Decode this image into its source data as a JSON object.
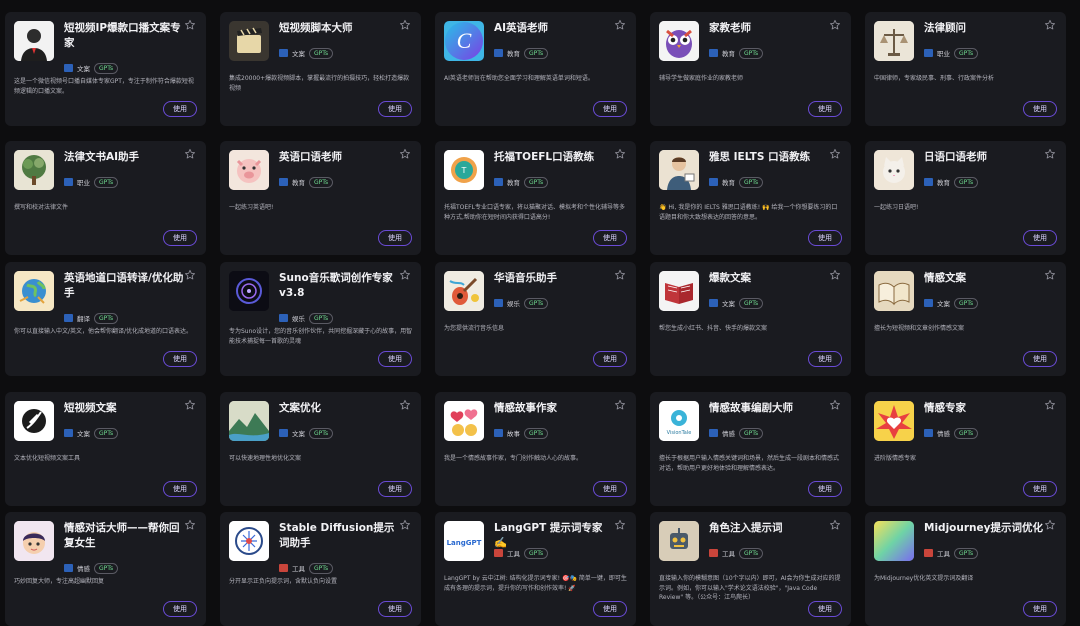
{
  "cards": [
    {
      "title": "短视频IP爆款口播文案专家",
      "category": "文案",
      "badge": "GPTs",
      "desc": "这是一个微信视频号口播自媒体专家GPT，专注于制作符合爆款短视频逻辑的口播文案。",
      "button": "使用",
      "avatar_color": "#f1f1f1",
      "avatar_icon": "person-photo-icon",
      "flag_color": "#2c61b8"
    },
    {
      "title": "短视频脚本大师",
      "category": "文案",
      "badge": "GPTs",
      "desc": "集成20000+爆款视频脚本，掌握最流行的拍摄技巧，轻松打造爆款视频",
      "button": "使用",
      "avatar_color": "#2a2a2a",
      "avatar_icon": "clapperboard-icon",
      "flag_color": "#2c61b8"
    },
    {
      "title": "AI英语老师",
      "category": "教育",
      "badge": "GPTs",
      "desc": "AI英语老师旨在帮助您全面学习和理解英语单词和短语。",
      "button": "使用",
      "avatar_color": "#3fb6e6",
      "avatar_icon": "letter-c-icon",
      "flag_color": "#2c61b8"
    },
    {
      "title": "家教老师",
      "category": "教育",
      "badge": "GPTs",
      "desc": "辅导学生做家庭作业的家教老师",
      "button": "使用",
      "avatar_color": "#f4f4f4",
      "avatar_icon": "owl-icon",
      "flag_color": "#2c61b8"
    },
    {
      "title": "法律顾问",
      "category": "职业",
      "badge": "GPTs",
      "desc": "中国律师，专家级民事、刑事、行政案件分析",
      "button": "使用",
      "avatar_color": "#ece6da",
      "avatar_icon": "scales-icon",
      "flag_color": "#2c61b8"
    },
    {
      "title": "法律文书AI助手",
      "category": "职业",
      "badge": "GPTs",
      "desc": "撰写和校对法律文件",
      "button": "使用",
      "avatar_color": "#e9e6d7",
      "avatar_icon": "tree-icon",
      "flag_color": "#2c61b8"
    },
    {
      "title": "英语口语老师",
      "category": "教育",
      "badge": "GPTs",
      "desc": "一起练习英语吧!",
      "button": "使用",
      "avatar_color": "#f3e6dd",
      "avatar_icon": "pig-icon",
      "flag_color": "#2c61b8"
    },
    {
      "title": "托福TOEFL口语教练",
      "category": "教育",
      "badge": "GPTs",
      "desc": "托福TOEFL专业口语专家，将以猫聚对话、模拟考和个性化辅导等多种方式,帮助你在短时间内获得口语高分!",
      "button": "使用",
      "avatar_color": "#ffffff",
      "avatar_icon": "toefl-logo-icon",
      "flag_color": "#2c61b8"
    },
    {
      "title": "雅思 IELTS 口语教练",
      "category": "教育",
      "badge": "GPTs",
      "desc": "👋 Hi, 我是你的 IELTS 雅思口语教练! 🙌 给我一个你想要练习的口语题目和你大致想表达的回答的意思。",
      "button": "使用",
      "avatar_color": "#ece3d4",
      "avatar_icon": "teacher-icon",
      "flag_color": "#2c61b8"
    },
    {
      "title": "日语口语老师",
      "category": "教育",
      "badge": "GPTs",
      "desc": "一起练习日语吧!",
      "button": "使用",
      "avatar_color": "#efe6d8",
      "avatar_icon": "cat-icon",
      "flag_color": "#2c61b8"
    },
    {
      "title": "英语地道口语转译/优化助手",
      "category": "翻译",
      "badge": "GPTs",
      "desc": "你可以直接输入中文/英文，他会帮你翻译/优化成地道的口语表达。",
      "button": "使用",
      "avatar_color": "#f6e7c4",
      "avatar_icon": "globe-icon",
      "flag_color": "#2c61b8"
    },
    {
      "title": "Suno音乐歌词创作专家v3.8",
      "category": "娱乐",
      "badge": "GPTs",
      "desc": "专为Suno设计，您的音乐创作伙伴，共同挖掘深藏于心的故事，用智能技术捕捉每一首歌的灵魂",
      "button": "使用",
      "avatar_color": "#0c0c14",
      "avatar_icon": "music-disc-icon",
      "flag_color": "#2c61b8"
    },
    {
      "title": "华语音乐助手",
      "category": "娱乐",
      "badge": "GPTs",
      "desc": "为您提供流行音乐信息",
      "button": "使用",
      "avatar_color": "#f0ece2",
      "avatar_icon": "guitar-icon",
      "flag_color": "#2c61b8"
    },
    {
      "title": "爆款文案",
      "category": "文案",
      "badge": "GPTs",
      "desc": "帮您生成小红书、抖音、快手的爆款文案",
      "button": "使用",
      "avatar_color": "#f4f4f4",
      "avatar_icon": "book-icon",
      "flag_color": "#2c61b8"
    },
    {
      "title": "情感文案",
      "category": "文案",
      "badge": "GPTs",
      "desc": "擅长为短视频和文章创作情感文案",
      "button": "使用",
      "avatar_color": "#e6d9bf",
      "avatar_icon": "open-book-icon",
      "flag_color": "#2c61b8"
    },
    {
      "title": "短视频文案",
      "category": "文案",
      "badge": "GPTs",
      "desc": "文本优化短视频文案工具",
      "button": "使用",
      "avatar_color": "#ffffff",
      "avatar_icon": "feather-icon",
      "flag_color": "#2c61b8"
    },
    {
      "title": "文案优化",
      "category": "文案",
      "badge": "GPTs",
      "desc": "可以快速地理性地优化文案",
      "button": "使用",
      "avatar_color": "#dcd8c7",
      "avatar_icon": "landscape-icon",
      "flag_color": "#2c61b8"
    },
    {
      "title": "情感故事作家",
      "category": "故事",
      "badge": "GPTs",
      "desc": "我是一个情感故事作家，专门创作触动人心的故事。",
      "button": "使用",
      "avatar_color": "#ffffff",
      "avatar_icon": "hearts-icon",
      "flag_color": "#2c61b8"
    },
    {
      "title": "情感故事编剧大师",
      "category": "情感",
      "badge": "GPTs",
      "desc": "擅长于根据用户输入情感关键词和场景，然后生成一段剧本和情感式对话，帮助用户更好地体验和理解情感表达。",
      "button": "使用",
      "avatar_color": "#ffffff",
      "avatar_icon": "vision-tale-icon",
      "flag_color": "#2c61b8"
    },
    {
      "title": "情感专家",
      "category": "情感",
      "badge": "GPTs",
      "desc": "进阶版情感专家",
      "button": "使用",
      "avatar_color": "#f7d24a",
      "avatar_icon": "heart-burst-icon",
      "flag_color": "#2c61b8"
    },
    {
      "title": "情感对话大师——帮你回复女生",
      "category": "情感",
      "badge": "GPTs",
      "desc": "巧妙回复大师，专注高超幽默回复",
      "button": "使用",
      "avatar_color": "#f1e6f0",
      "avatar_icon": "cartoon-boy-icon",
      "flag_color": "#2c61b8"
    },
    {
      "title": "Stable Diffusion提示词助手",
      "category": "工具",
      "badge": "GPTs",
      "desc": "分开显示正负向提示词，含默认负向设置",
      "button": "使用",
      "avatar_color": "#ffffff",
      "avatar_icon": "brain-circuit-icon",
      "flag_color": "#c9453b"
    },
    {
      "title": "LangGPT 提示词专家 ✍️",
      "category": "工具",
      "badge": "GPTs",
      "desc": "LangGPT by 云中江树: 结构化提示词专家! 🎯🎭 简单一键，即可生成有条理的提示词，提升你的写作和创作效率! 🚀",
      "button": "使用",
      "avatar_color": "#ffffff",
      "avatar_icon": "langgpt-logo-icon",
      "flag_color": "#c9453b"
    },
    {
      "title": "角色注入提示词",
      "category": "工具",
      "badge": "GPTs",
      "desc": "直接输入你的模糊意图（10个字以内）即可，AI会为你生成对应的提示词。例如，你可以输入\"学术论文语法校验\"，\"Java Code Review\" 等。（公众号：江鸟爬长）",
      "button": "使用",
      "avatar_color": "#d8cdb8",
      "avatar_icon": "robot-icon",
      "flag_color": "#c9453b"
    },
    {
      "title": "Midjourney提示词优化",
      "category": "工具",
      "badge": "GPTs",
      "desc": "为Midjourney优化英文提示词及翻译",
      "button": "使用",
      "avatar_color": "#7fd3a8",
      "avatar_icon": "gradient-square-icon",
      "flag_color": "#c9453b"
    }
  ]
}
